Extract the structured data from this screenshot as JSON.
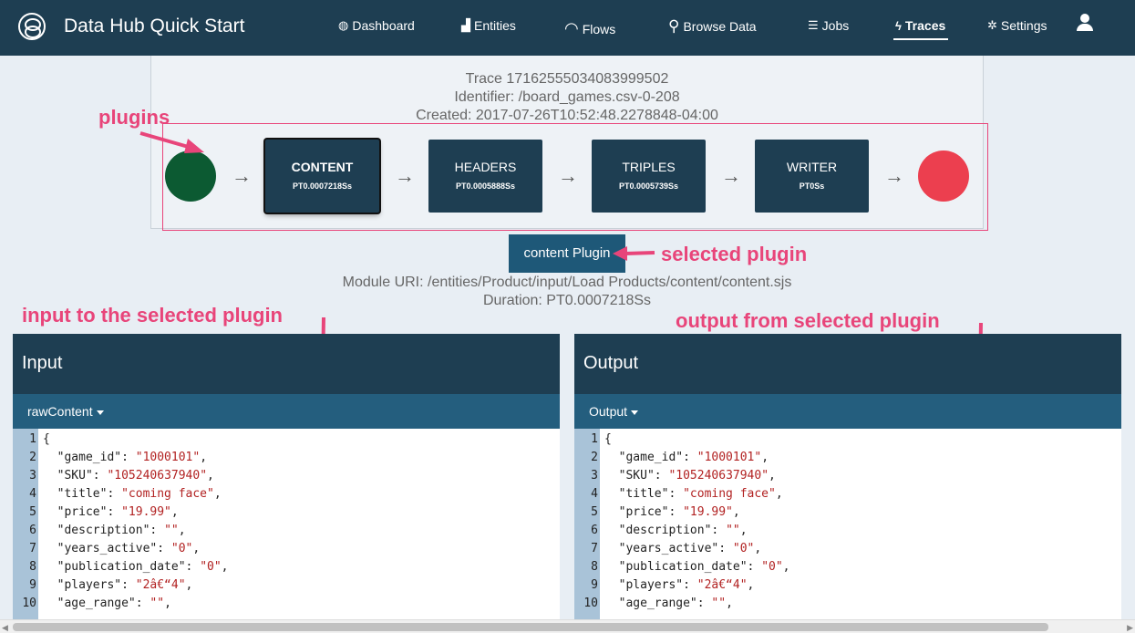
{
  "app": {
    "title": "Data Hub Quick Start"
  },
  "nav": [
    {
      "label": "Dashboard",
      "icon": "dashboard-icon",
      "glyph": "◍"
    },
    {
      "label": "Entities",
      "icon": "factory-icon",
      "glyph": "▟"
    },
    {
      "label": "Flows",
      "icon": "flows-icon",
      "glyph": "◠"
    },
    {
      "label": "Browse Data",
      "icon": "search-icon",
      "glyph": "⚲"
    },
    {
      "label": "Jobs",
      "icon": "jobs-icon",
      "glyph": "☰"
    },
    {
      "label": "Traces",
      "icon": "bolt-icon",
      "glyph": "ϟ"
    },
    {
      "label": "Settings",
      "icon": "gear-icon",
      "glyph": "✲"
    }
  ],
  "trace": {
    "id_line": "Trace 17162555034083999502",
    "identifier_line": "Identifier: /board_games.csv-0-208",
    "created_line": "Created: 2017-07-26T10:52:48.2278848-04:00"
  },
  "plugins": [
    {
      "name": "CONTENT",
      "duration": "PT0.0007218Ss"
    },
    {
      "name": "HEADERS",
      "duration": "PT0.0005888Ss"
    },
    {
      "name": "TRIPLES",
      "duration": "PT0.0005739Ss"
    },
    {
      "name": "WRITER",
      "duration": "PT0Ss"
    }
  ],
  "selected": {
    "button_label": "content Plugin",
    "module_uri": "Module URI: /entities/Product/input/Load Products/content/content.sjs",
    "duration": "Duration: PT0.0007218Ss"
  },
  "annotations": {
    "plugins": "plugins",
    "selected_plugin": "selected plugin",
    "input": "input to the selected plugin",
    "output": "output from selected plugin"
  },
  "colors": {
    "annotation": "#e8457a",
    "nav_bg": "#1e3e52",
    "start": "#0c5a32",
    "end": "#ec3f4f"
  },
  "input_panel": {
    "title": "Input",
    "dropdown": "rawContent"
  },
  "output_panel": {
    "title": "Output",
    "dropdown": "Output"
  },
  "code_lines": [
    {
      "n": "1",
      "key": "{",
      "val": "",
      "tail": ""
    },
    {
      "n": "2",
      "key": "  \"game_id\": ",
      "val": "\"1000101\"",
      "tail": ","
    },
    {
      "n": "3",
      "key": "  \"SKU\": ",
      "val": "\"105240637940\"",
      "tail": ","
    },
    {
      "n": "4",
      "key": "  \"title\": ",
      "val": "\"coming face\"",
      "tail": ","
    },
    {
      "n": "5",
      "key": "  \"price\": ",
      "val": "\"19.99\"",
      "tail": ","
    },
    {
      "n": "6",
      "key": "  \"description\": ",
      "val": "\"\"",
      "tail": ","
    },
    {
      "n": "7",
      "key": "  \"years_active\": ",
      "val": "\"0\"",
      "tail": ","
    },
    {
      "n": "8",
      "key": "  \"publication_date\": ",
      "val": "\"0\"",
      "tail": ","
    },
    {
      "n": "9",
      "key": "  \"players\": ",
      "val": "\"2â€“4\"",
      "tail": ","
    },
    {
      "n": "10",
      "key": "  \"age_range\": ",
      "val": "\"\"",
      "tail": ","
    }
  ]
}
